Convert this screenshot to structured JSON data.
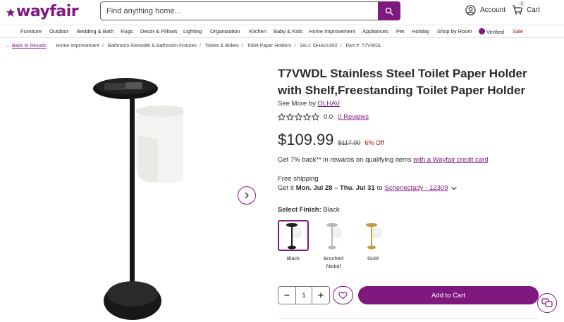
{
  "brand": {
    "logo_text": "wayfair",
    "accent_color": "#7f187f"
  },
  "header": {
    "search_placeholder": "Find anything home...",
    "account_label": "Account",
    "cart_label": "Cart",
    "cart_count": "1"
  },
  "nav": {
    "items": [
      "Furniture",
      "Outdoor",
      "Bedding & Bath",
      "Rugs",
      "Decor & Pillows",
      "Lighting",
      "Organization",
      "Kitchen",
      "Baby & Kids",
      "Home Improvement",
      "Appliances",
      "Pet",
      "Holiday",
      "Shop by Room",
      "Verified",
      "Sale"
    ]
  },
  "breadcrumb": {
    "back": "Back to Results",
    "items": [
      "Home Improvement",
      "Bathroom Remodel & Bathroom Fixtures",
      "Toilets & Bidets",
      "Toilet Paper Holders",
      "SKU: OHAV1450",
      "Part #: T7VWDL"
    ]
  },
  "product": {
    "title": "T7VWDL Stainless Steel Toilet Paper Holder with Shelf,Freestanding Toilet Paper Holder",
    "see_more_prefix": "See More by",
    "brand_name": "OLHAV",
    "rating_value": "0.0",
    "reviews_label": "0 Reviews",
    "rating": 0,
    "price": "$109.99",
    "old_price": "$117.00",
    "discount": "6% Off",
    "rewards_text": "Get 7% back** in rewards on qualifying items",
    "rewards_link": "with a Wayfair credit card",
    "shipping": "Free shipping",
    "delivery_prefix": "Get it",
    "delivery_dates": "Mon. Jul 28 – Thu. Jul 31",
    "delivery_to": "to",
    "delivery_location": "Schenectady - 12309",
    "finish_label": "Select Finish:",
    "finish_selected": "Black",
    "finishes": [
      {
        "label": "Black",
        "color": "#1c1c1c"
      },
      {
        "label": "Brushed Nickel",
        "color": "#b9b9b9"
      },
      {
        "label": "Gold",
        "color": "#c99a3c"
      }
    ],
    "quantity": "1",
    "add_to_cart": "Add to Cart"
  }
}
